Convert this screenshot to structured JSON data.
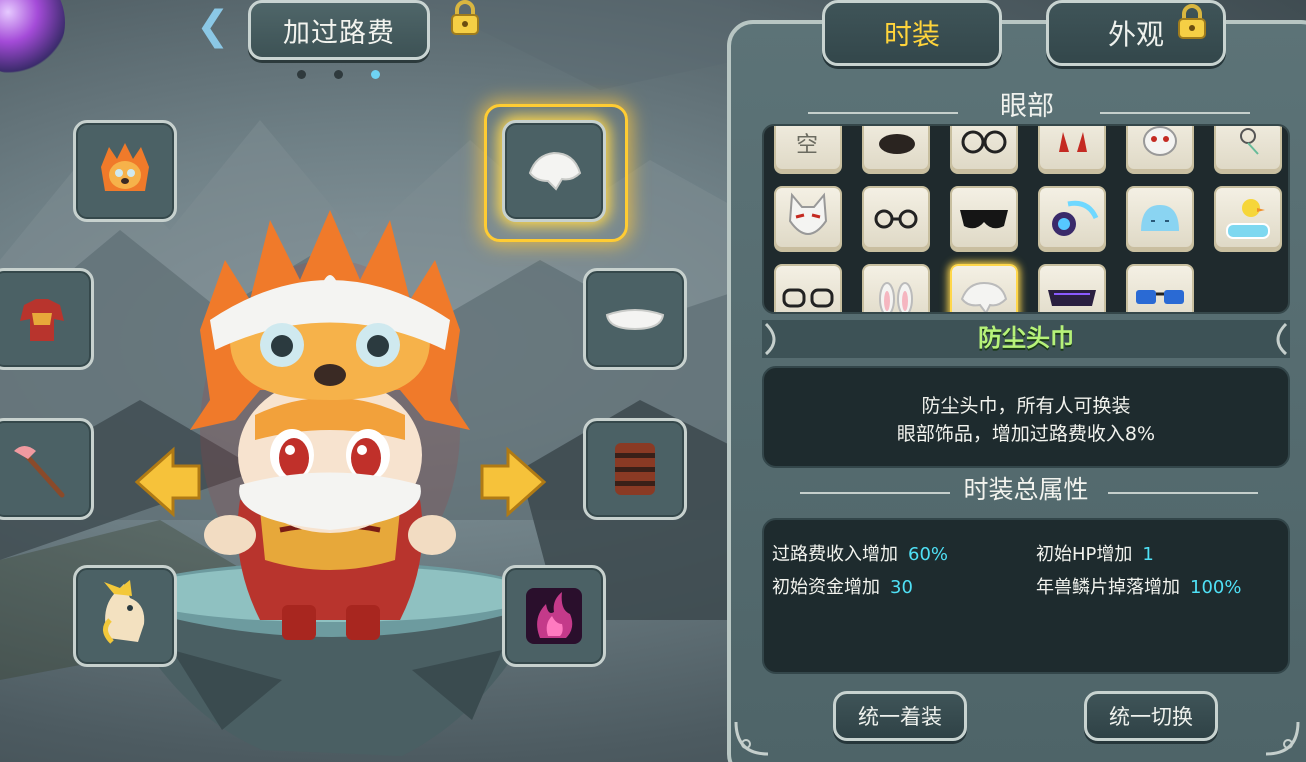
{
  "header": {
    "title": "加过路费",
    "pager": {
      "count": 3,
      "active_index": 2
    }
  },
  "tabs": [
    {
      "label": "时装",
      "active": true,
      "locked": false
    },
    {
      "label": "外观",
      "active": false,
      "locked": true
    }
  ],
  "category": {
    "label": "眼部"
  },
  "selected_item": {
    "name": "防尘头巾",
    "description_lines": [
      "防尘头巾，所有人可换装",
      "眼部饰品，增加过路费收入8%"
    ]
  },
  "attributes": {
    "title": "时装总属性",
    "items": [
      {
        "label": "过路费收入增加",
        "value": "60%"
      },
      {
        "label": "初始HP增加",
        "value": "1"
      },
      {
        "label": "初始资金增加",
        "value": "30"
      },
      {
        "label": "年兽鳞片掉落增加",
        "value": "100%"
      }
    ]
  },
  "buttons": {
    "wear_all": "统一着装",
    "switch_all": "统一切换"
  },
  "colors": {
    "accent_gold": "#ffd43b",
    "item_name_green": "#b6f279",
    "value_cyan": "#4fe0f5"
  }
}
